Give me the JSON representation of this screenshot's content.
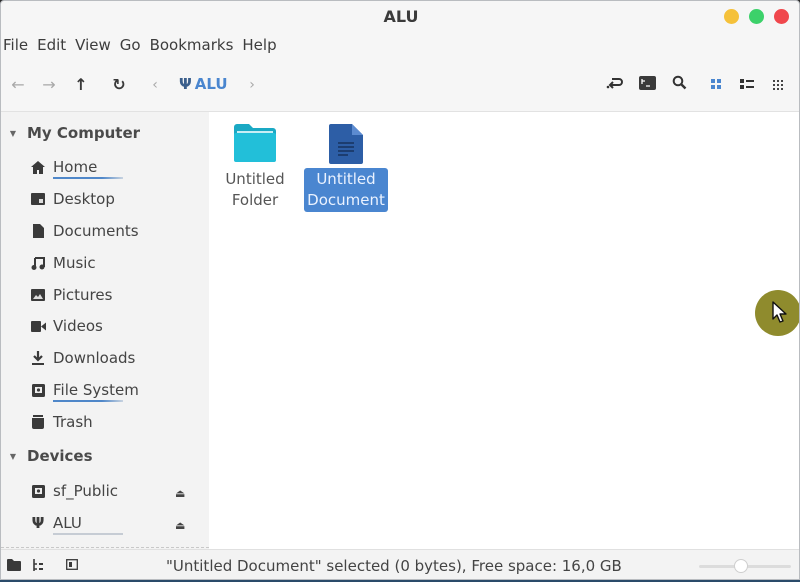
{
  "window": {
    "title": "ALU",
    "controls": {
      "minimize_color": "#f5c13a",
      "maximize_color": "#3cd16a",
      "close_color": "#f0474c"
    }
  },
  "menubar": {
    "items": [
      "File",
      "Edit",
      "View",
      "Go",
      "Bookmarks",
      "Help"
    ]
  },
  "toolbar": {
    "back": "←",
    "forward": "→",
    "up": "↑",
    "reload": "↻",
    "crumb_prev": "‹",
    "crumb_next": "›",
    "breadcrumb": {
      "icon": "Ψ",
      "label": "ALU"
    },
    "right_icons": [
      "toggle-location-icon",
      "terminal-icon",
      "search-icon",
      "icon-view-icon",
      "list-view-icon",
      "compact-view-icon"
    ],
    "accent_color": "#4a86cf"
  },
  "sidebar": {
    "sections": [
      {
        "label": "My Computer",
        "items": [
          {
            "label": "Home",
            "icon": "home-icon"
          },
          {
            "label": "Desktop",
            "icon": "desktop-icon"
          },
          {
            "label": "Documents",
            "icon": "documents-icon"
          },
          {
            "label": "Music",
            "icon": "music-icon"
          },
          {
            "label": "Pictures",
            "icon": "pictures-icon"
          },
          {
            "label": "Videos",
            "icon": "videos-icon"
          },
          {
            "label": "Downloads",
            "icon": "downloads-icon"
          },
          {
            "label": "File System",
            "icon": "drive-icon"
          },
          {
            "label": "Trash",
            "icon": "trash-icon"
          }
        ]
      },
      {
        "label": "Devices",
        "items": [
          {
            "label": "sf_Public",
            "icon": "drive-icon",
            "eject": "⏏"
          },
          {
            "label": "ALU",
            "icon": "usb-icon",
            "eject": "⏏"
          }
        ]
      }
    ]
  },
  "content": {
    "items": [
      {
        "name_line1": "Untitled",
        "name_line2": "Folder",
        "type": "folder",
        "selected": false,
        "color": "#1fb4cf"
      },
      {
        "name_line1": "Untitled",
        "name_line2": "Document",
        "type": "document",
        "selected": true,
        "color": "#2f5fa8"
      }
    ]
  },
  "statusbar": {
    "text": "\"Untitled Document\" selected (0 bytes), Free space: 16,0 GB",
    "zoom_level": 0.45
  }
}
